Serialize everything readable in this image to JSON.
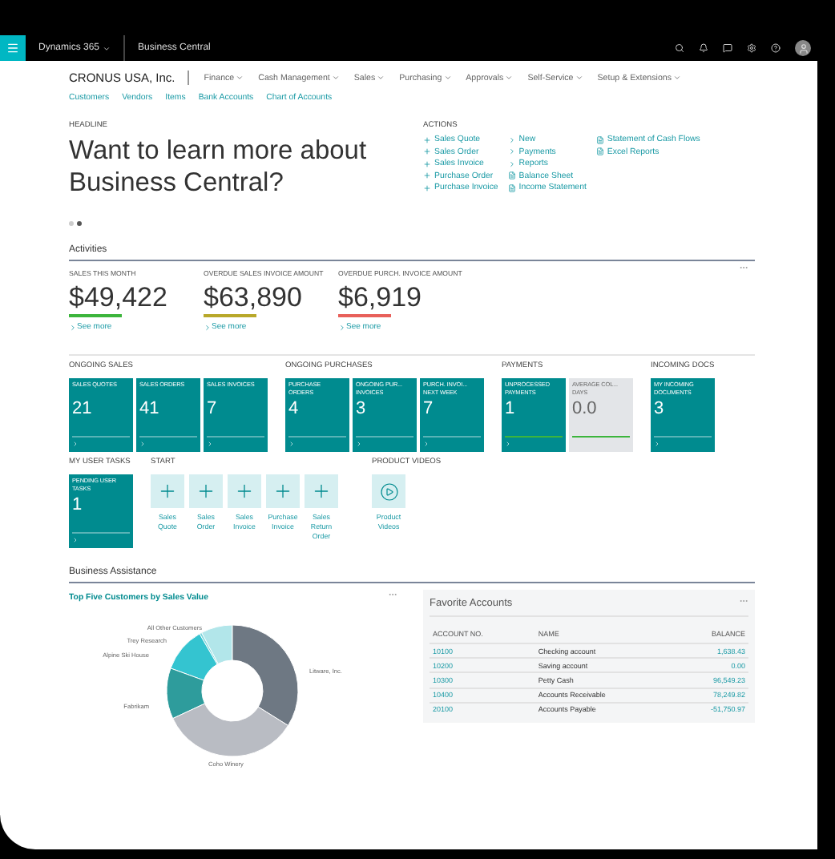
{
  "top_bar": {
    "product": "Dynamics 365",
    "app": "Business Central"
  },
  "company": "CRONUS USA, Inc.",
  "menus": [
    {
      "label": "Finance"
    },
    {
      "label": "Cash Management"
    },
    {
      "label": "Sales"
    },
    {
      "label": "Purchasing"
    },
    {
      "label": "Approvals"
    },
    {
      "label": "Self-Service"
    },
    {
      "label": "Setup & Extensions"
    }
  ],
  "quick_links": [
    "Customers",
    "Vendors",
    "Items",
    "Bank Accounts",
    "Chart of Accounts"
  ],
  "headline": {
    "label": "HEADLINE",
    "text": "Want to learn more about Business Central?",
    "pages": [
      {
        "selected": false
      },
      {
        "selected": true
      }
    ]
  },
  "actions": {
    "label": "ACTIONS",
    "columns": [
      [
        {
          "kind": "new",
          "label": "Sales Quote"
        },
        {
          "kind": "new",
          "label": "Sales Order"
        },
        {
          "kind": "new",
          "label": "Sales Invoice"
        },
        {
          "kind": "new",
          "label": "Purchase Order"
        },
        {
          "kind": "new",
          "label": "Purchase Invoice"
        }
      ],
      [
        {
          "kind": "menu",
          "label": "New"
        },
        {
          "kind": "menu",
          "label": "Payments"
        },
        {
          "kind": "menu",
          "label": "Reports"
        },
        {
          "kind": "report",
          "label": "Balance Sheet"
        },
        {
          "kind": "report",
          "label": "Income Statement"
        }
      ],
      [
        {
          "kind": "report",
          "label": "Statement of Cash Flows"
        },
        {
          "kind": "report",
          "label": "Excel Reports"
        }
      ]
    ]
  },
  "activities": {
    "title": "Activities",
    "cues": [
      {
        "label": "SALES THIS MONTH",
        "value": "$49,422",
        "color": "#3cb53c",
        "link": "See more"
      },
      {
        "label": "OVERDUE SALES INVOICE AMOUNT",
        "value": "$63,890",
        "color": "#b8a82a",
        "link": "See more"
      },
      {
        "label": "OVERDUE PURCH. INVOICE AMOUNT",
        "value": "$6,919",
        "color": "#e8605a",
        "link": "See more"
      }
    ],
    "groups": [
      {
        "label": "ONGOING SALES",
        "tiles": [
          {
            "kind": "teal",
            "title": "SALES QUOTES",
            "value": "21"
          },
          {
            "kind": "teal",
            "title": "SALES ORDERS",
            "value": "41"
          },
          {
            "kind": "teal",
            "title": "SALES INVOICES",
            "value": "7"
          }
        ]
      },
      {
        "label": "ONGOING PURCHASES",
        "tiles": [
          {
            "kind": "teal",
            "title": "PURCHASE ORDERS",
            "value": "4"
          },
          {
            "kind": "teal",
            "title": "ONGOING PUR... INVOICES",
            "value": "3"
          },
          {
            "kind": "teal",
            "title": "PURCH. INVOI... NEXT WEEK",
            "value": "7"
          }
        ]
      },
      {
        "label": "PAYMENTS",
        "tiles": [
          {
            "kind": "teal",
            "title": "UNPROCESSED PAYMENTS",
            "value": "1",
            "color": "#3cb53c"
          },
          {
            "kind": "grey",
            "title": "AVERAGE COL... DAYS",
            "value": "0.0",
            "color": "#3cb53c"
          }
        ]
      },
      {
        "label": "INCOMING DOCS",
        "tiles": [
          {
            "kind": "teal",
            "title": "MY INCOMING DOCUMENTS",
            "value": "3"
          }
        ]
      }
    ],
    "user_tasks": {
      "label": "MY USER TASKS",
      "tiles": [
        {
          "kind": "teal",
          "title": "PENDING USER TASKS",
          "value": "1"
        }
      ]
    },
    "start": {
      "label": "START",
      "items": [
        {
          "kind": "new",
          "label": "Sales Quote"
        },
        {
          "kind": "new",
          "label": "Sales Order"
        },
        {
          "kind": "new",
          "label": "Sales Invoice"
        },
        {
          "kind": "new",
          "label": "Purchase Invoice"
        },
        {
          "kind": "new",
          "label": "Sales Return Order"
        }
      ]
    },
    "videos": {
      "label": "PRODUCT VIDEOS",
      "items": [
        {
          "kind": "video",
          "label": "Product Videos"
        }
      ]
    }
  },
  "business_assistance": {
    "title": "Business Assistance",
    "chart": {
      "title": "Top Five Customers by Sales Value",
      "slices": [
        {
          "label": "All Other Customers",
          "color": "#b2e6ea"
        },
        {
          "label": "Trey Research",
          "color": "#7fd6dc"
        },
        {
          "label": "Alpine Ski House",
          "color": "#34c4d0"
        },
        {
          "label": "Litware, Inc.",
          "color": "#6e7883"
        },
        {
          "label": "Fabrikam",
          "color": "#2e9c9c"
        },
        {
          "label": "Coho Winery",
          "color": "#b9bcc3"
        }
      ]
    },
    "favorites": {
      "title": "Favorite Accounts",
      "columns": [
        "ACCOUNT NO.",
        "NAME",
        "BALANCE"
      ],
      "rows": [
        [
          "10100",
          "Checking account",
          "1,638.43"
        ],
        [
          "10200",
          "Saving account",
          "0.00"
        ],
        [
          "10300",
          "Petty Cash",
          "96,549.23"
        ],
        [
          "10400",
          "Accounts Receivable",
          "78,249.82"
        ],
        [
          "20100",
          "Accounts Payable",
          "-51,750.97"
        ]
      ]
    }
  }
}
